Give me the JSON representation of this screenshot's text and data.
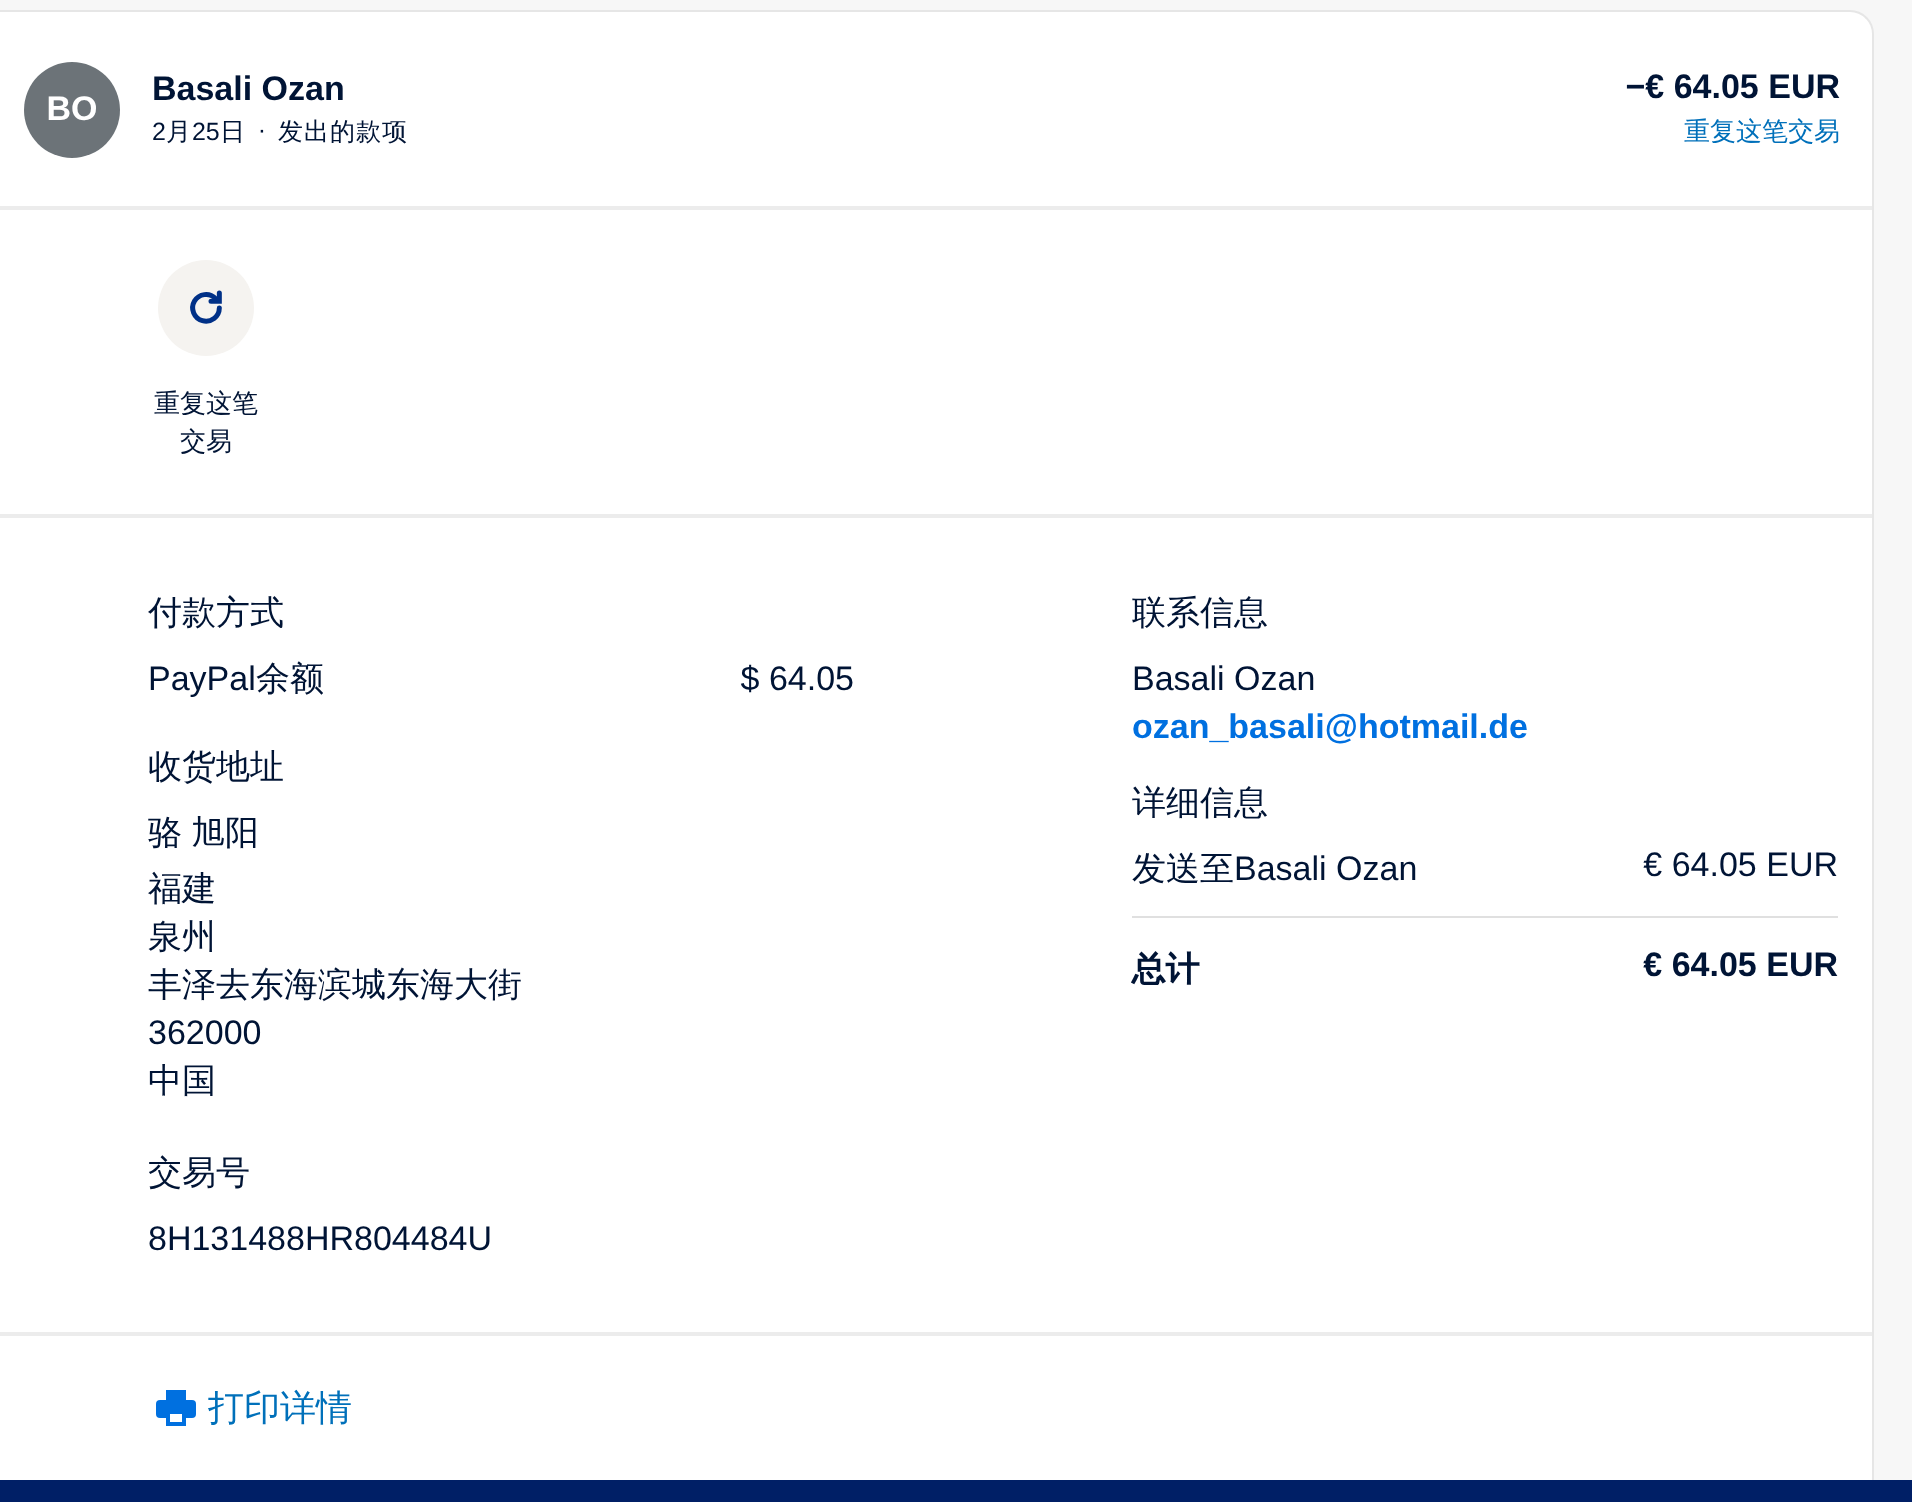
{
  "header": {
    "avatar": "BO",
    "name": "Basali Ozan",
    "date": "2月25日",
    "separator": "·",
    "type": "发出的款项",
    "amount": "−€ 64.05 EUR",
    "repeat_link": "重复这笔交易"
  },
  "actions": [
    {
      "label": "重复这笔交易"
    }
  ],
  "payment": {
    "title": "付款方式",
    "method": "PayPal余额",
    "amount": "$ 64.05"
  },
  "shipping": {
    "title": "收货地址",
    "lines": [
      "骆 旭阳",
      "福建",
      "泉州",
      "丰泽去东海滨城东海大街",
      "362000",
      "中国"
    ]
  },
  "transaction": {
    "title": "交易号",
    "id": "8H131488HR804484U"
  },
  "contact": {
    "title": "联系信息",
    "name": "Basali Ozan",
    "email": "ozan_basali@hotmail.de"
  },
  "details": {
    "title": "详细信息",
    "rows": [
      {
        "label": "发送至Basali Ozan",
        "value": "€ 64.05 EUR",
        "kind": "item"
      },
      {
        "label": "总计",
        "value": "€ 64.05 EUR",
        "kind": "total"
      }
    ]
  },
  "footer": {
    "print": "打印详情"
  }
}
